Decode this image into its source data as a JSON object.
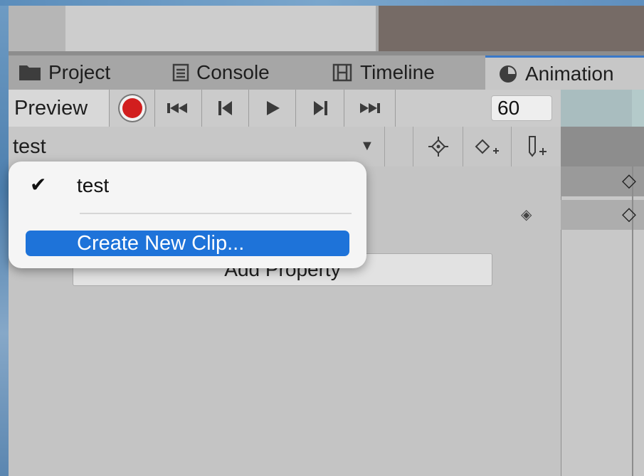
{
  "tabs": [
    {
      "label": "Project",
      "icon": "folder-icon"
    },
    {
      "label": "Console",
      "icon": "console-icon"
    },
    {
      "label": "Timeline",
      "icon": "timeline-icon"
    },
    {
      "label": "Animation",
      "icon": "clock-icon"
    }
  ],
  "toolbar": {
    "preview_label": "Preview",
    "frame_value": "60"
  },
  "clip": {
    "selected": "test"
  },
  "properties": {
    "add_label": "Add Property"
  },
  "menu": {
    "items": [
      {
        "label": "test",
        "checked": true
      },
      {
        "label": "Create New Clip...",
        "highlighted": true
      }
    ]
  },
  "colors": {
    "accent": "#1e73d9",
    "record": "#d21e1e"
  }
}
